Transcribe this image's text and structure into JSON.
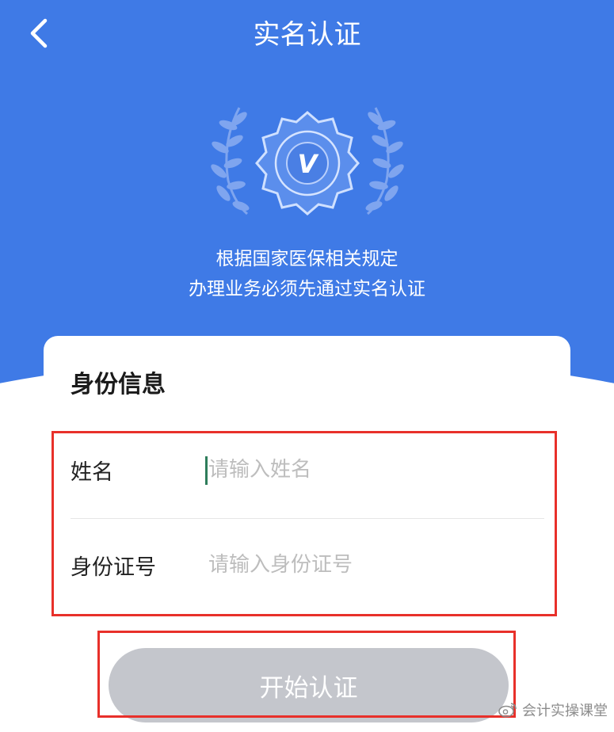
{
  "header": {
    "title": "实名认证",
    "back_icon": "chevron-left-icon"
  },
  "emblem": {
    "badge_letter": "V",
    "icons": [
      "laurel-left-icon",
      "verified-badge-icon",
      "laurel-right-icon"
    ]
  },
  "notice": {
    "line1": "根据国家医保相关规定",
    "line2": "办理业务必须先通过实名认证"
  },
  "card": {
    "title": "身份信息",
    "fields": [
      {
        "label": "姓名",
        "value": "",
        "placeholder": "请输入姓名"
      },
      {
        "label": "身份证号",
        "value": "",
        "placeholder": "请输入身份证号"
      }
    ]
  },
  "action": {
    "start_label": "开始认证"
  },
  "watermark": {
    "text": "会计实操课堂",
    "icon": "weibo-icon"
  },
  "colors": {
    "header_bg": "#3f7ae6",
    "highlight": "#e8302a",
    "button_disabled": "#c4c6cc",
    "caret": "#2e7d5b"
  }
}
